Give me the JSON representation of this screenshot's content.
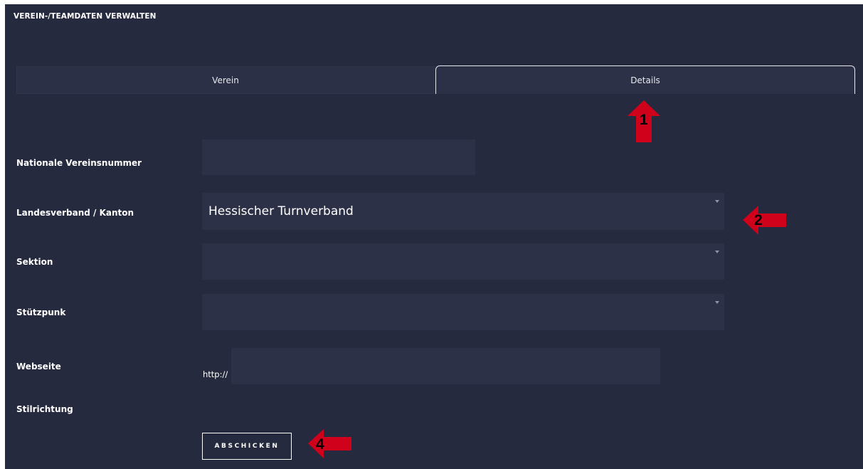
{
  "page": {
    "title": "VEREIN-/TEAMDATEN VERWALTEN"
  },
  "tabs": [
    {
      "label": "Verein",
      "active": false
    },
    {
      "label": "Details",
      "active": true
    }
  ],
  "form": {
    "national_number": {
      "label": "Nationale Vereinsnummer",
      "value": ""
    },
    "landesverband": {
      "label": "Landesverband / Kanton",
      "value": "Hessischer Turnverband"
    },
    "sektion": {
      "label": "Sektion",
      "value": ""
    },
    "stuetzpunkt": {
      "label": "Stützpunk",
      "value": ""
    },
    "webseite": {
      "label": "Webseite",
      "prefix": "http://",
      "value": ""
    },
    "stilrichtung": {
      "label": "Stilrichtung"
    },
    "submit_label": "ABSCHICKEN"
  },
  "annotations": [
    {
      "number": "1",
      "direction": "up",
      "color": "#d0021b"
    },
    {
      "number": "2",
      "direction": "left",
      "color": "#d0021b"
    },
    {
      "number": "4",
      "direction": "left",
      "color": "#d0021b"
    }
  ],
  "colors": {
    "background": "#262a3f",
    "field": "#2d3147",
    "accent": "#d0021b"
  },
  "icons": {
    "select_caret": "caret-down-icon",
    "annotation_arrow": "red-arrow-icon"
  }
}
